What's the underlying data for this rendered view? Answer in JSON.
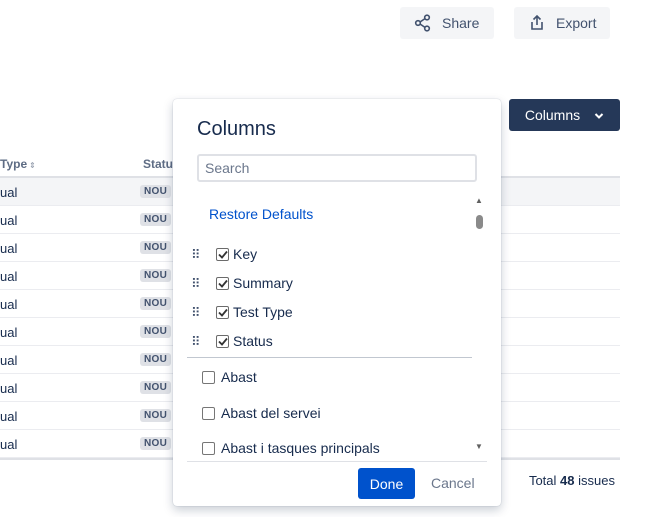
{
  "toolbar": {
    "share_label": "Share",
    "export_label": "Export"
  },
  "table": {
    "headers": {
      "type": "Type",
      "status": "Status"
    },
    "rows": [
      {
        "type": "ual",
        "status": "NOU"
      },
      {
        "type": "ual",
        "status": "NOU"
      },
      {
        "type": "ual",
        "status": "NOU"
      },
      {
        "type": "ual",
        "status": "NOU"
      },
      {
        "type": "ual",
        "status": "NOU"
      },
      {
        "type": "ual",
        "status": "NOU"
      },
      {
        "type": "ual",
        "status": "NOU"
      },
      {
        "type": "ual",
        "status": "NOU"
      },
      {
        "type": "ual",
        "status": "NOU"
      },
      {
        "type": "ual",
        "status": "NOU"
      }
    ],
    "total_prefix": "Total",
    "total_count": "48",
    "total_suffix": "issues"
  },
  "columns_button": {
    "label": "Columns"
  },
  "popup": {
    "title": "Columns",
    "search_placeholder": "Search",
    "restore_label": "Restore Defaults",
    "selected": [
      {
        "label": "Key",
        "checked": true
      },
      {
        "label": "Summary",
        "checked": true
      },
      {
        "label": "Test Type",
        "checked": true
      },
      {
        "label": "Status",
        "checked": true
      }
    ],
    "options": [
      {
        "label": "Abast",
        "checked": false
      },
      {
        "label": "Abast del servei",
        "checked": false
      },
      {
        "label": "Abast i tasques principals",
        "checked": false
      }
    ],
    "done_label": "Done",
    "cancel_label": "Cancel"
  },
  "colors": {
    "primary": "#0052cc",
    "columns_button_bg": "#253858",
    "link": "#0052cc"
  }
}
